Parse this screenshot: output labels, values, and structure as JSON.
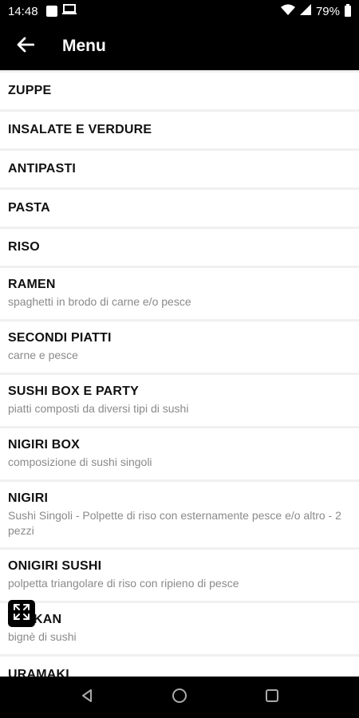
{
  "status": {
    "time": "14:48",
    "battery": "79%"
  },
  "appbar": {
    "title": "Menu"
  },
  "menu": {
    "items": [
      {
        "name": "ZUPPE",
        "desc": ""
      },
      {
        "name": "INSALATE E VERDURE",
        "desc": ""
      },
      {
        "name": "ANTIPASTI",
        "desc": ""
      },
      {
        "name": "PASTA",
        "desc": ""
      },
      {
        "name": "RISO",
        "desc": ""
      },
      {
        "name": "RAMEN",
        "desc": "spaghetti in brodo di carne e/o pesce"
      },
      {
        "name": "SECONDI PIATTI",
        "desc": "carne e pesce"
      },
      {
        "name": "SUSHI BOX E PARTY",
        "desc": "piatti composti da diversi tipi di sushi"
      },
      {
        "name": "NIGIRI BOX",
        "desc": "composizione di sushi singoli"
      },
      {
        "name": "NIGIRI",
        "desc": "Sushi Singoli - Polpette di riso con esternamente pesce e/o altro - 2 pezzi"
      },
      {
        "name": "ONIGIRI SUSHI",
        "desc": "polpetta triangolare di riso con ripieno di pesce"
      },
      {
        "name": "KAN",
        "desc": "bignè di sushi"
      },
      {
        "name": "URAMAKI",
        "desc": ""
      }
    ]
  },
  "icons": {
    "back": "arrow-left-icon",
    "fullscreen": "expand-icon",
    "nav_back": "triangle-back-icon",
    "nav_home": "circle-home-icon",
    "nav_recents": "square-recents-icon"
  }
}
